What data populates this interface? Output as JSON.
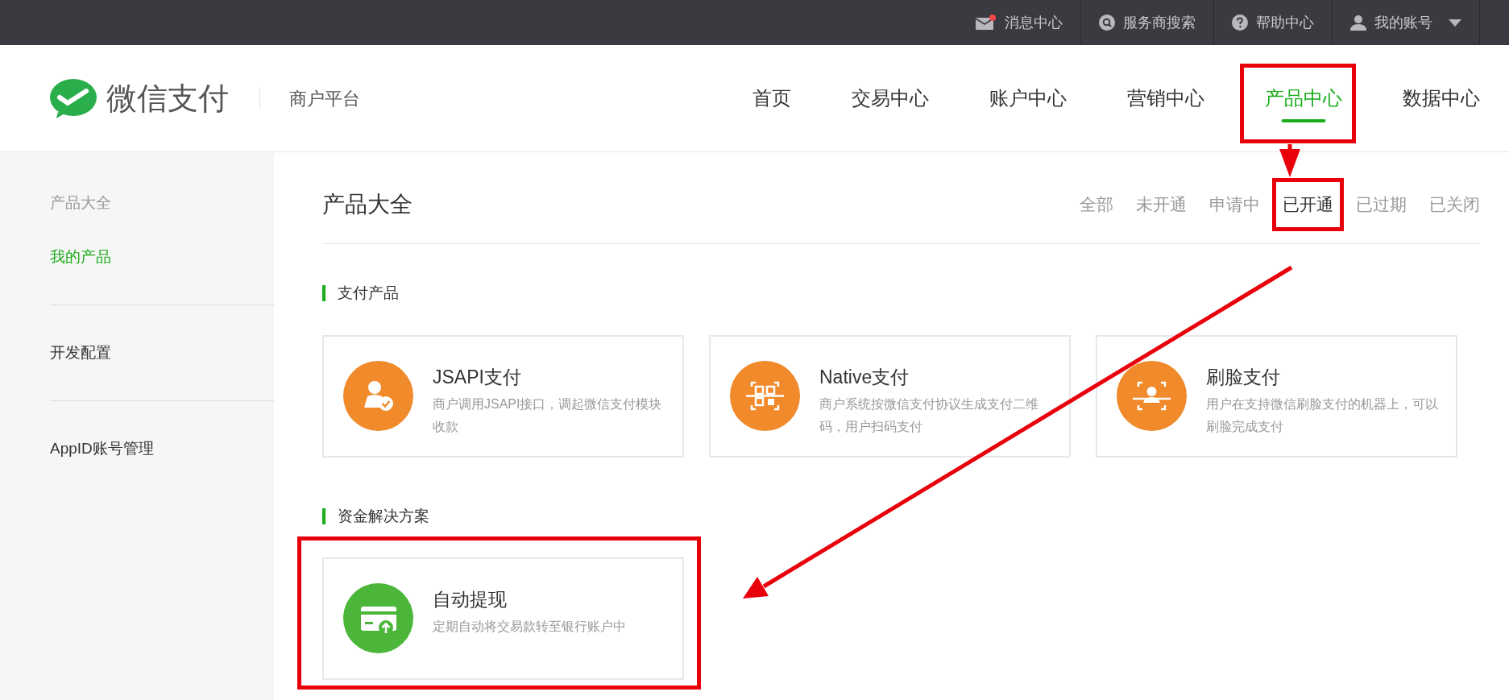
{
  "top_bar": {
    "items": [
      {
        "kind": "messages",
        "label": "消息中心",
        "unread": true
      },
      {
        "kind": "search",
        "label": "服务商搜索"
      },
      {
        "kind": "help",
        "label": "帮助中心"
      },
      {
        "kind": "account",
        "label": "我的账号"
      }
    ]
  },
  "header": {
    "logo": "微信支付",
    "subtitle": "商户平台",
    "nav": [
      {
        "label": "首页",
        "selected": false,
        "highlighted": false
      },
      {
        "label": "交易中心",
        "selected": false,
        "highlighted": false
      },
      {
        "label": "账户中心",
        "selected": false,
        "highlighted": false
      },
      {
        "label": "营销中心",
        "selected": false,
        "highlighted": false
      },
      {
        "label": "产品中心",
        "selected": true,
        "highlighted": true
      },
      {
        "label": "数据中心",
        "selected": false,
        "highlighted": false
      }
    ]
  },
  "sidebar": {
    "items": [
      {
        "kind": "heading",
        "label": "产品大全"
      },
      {
        "kind": "link",
        "label": "我的产品",
        "selected": true
      },
      {
        "kind": "link",
        "label": "开发配置",
        "selected": false
      },
      {
        "kind": "link",
        "label": "AppID账号管理",
        "selected": false
      }
    ]
  },
  "content": {
    "title": "产品大全",
    "filters": [
      {
        "label": "全部",
        "selected": false,
        "highlighted": false
      },
      {
        "label": "未开通",
        "selected": false,
        "highlighted": false
      },
      {
        "label": "申请中",
        "selected": false,
        "highlighted": false
      },
      {
        "label": "已开通",
        "selected": true,
        "highlighted": true
      },
      {
        "label": "已过期",
        "selected": false,
        "highlighted": false
      },
      {
        "label": "已关闭",
        "selected": false,
        "highlighted": false
      }
    ],
    "sections": [
      {
        "title": "支付产品",
        "products": [
          {
            "kind": "jsapi",
            "name": "JSAPI支付",
            "description": "商户调用JSAPI接口，调起微信支付模块收款",
            "highlighted": false
          },
          {
            "kind": "native",
            "name": "Native支付",
            "description": "商户系统按微信支付协议生成支付二维码，用户扫码支付",
            "highlighted": false
          },
          {
            "kind": "face",
            "name": "刷脸支付",
            "description": "用户在支持微信刷脸支付的机器上，可以刷脸完成支付",
            "highlighted": false
          }
        ]
      },
      {
        "title": "资金解决方案",
        "products": [
          {
            "kind": "withdraw",
            "name": "自动提现",
            "description": "定期自动将交易款转至银行账户中",
            "highlighted": true
          }
        ]
      }
    ]
  }
}
